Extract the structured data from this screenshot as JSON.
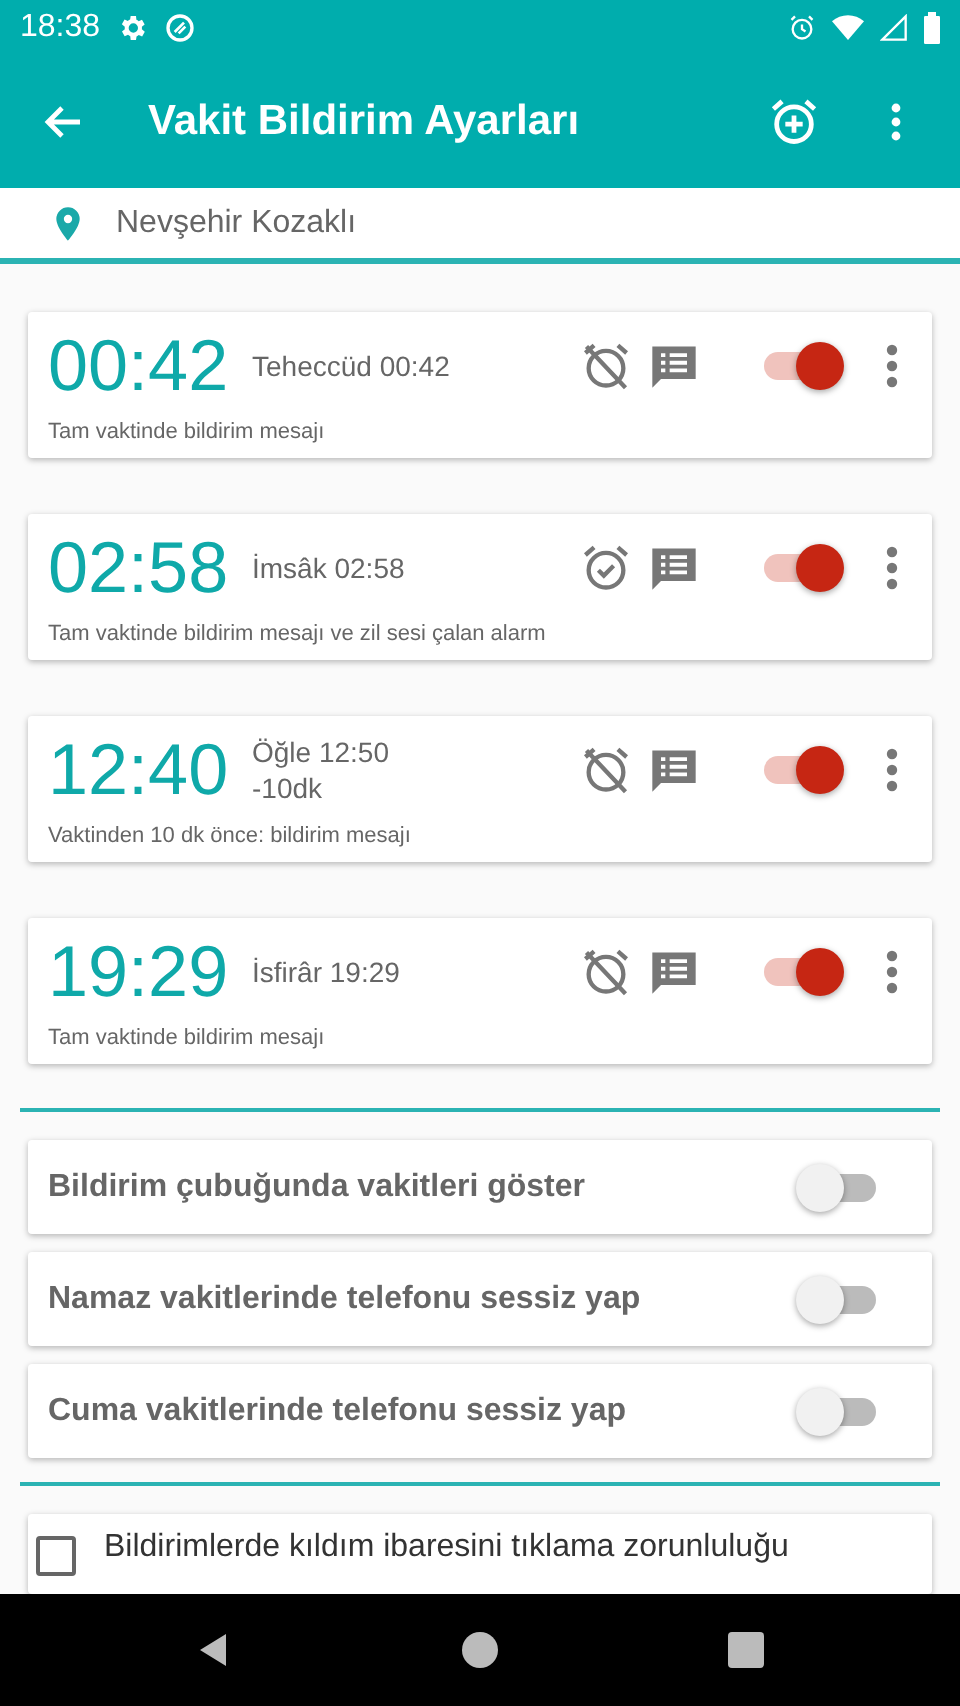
{
  "status_bar": {
    "time": "18:38"
  },
  "app_bar": {
    "title": "Vakit Bildirim Ayarları"
  },
  "location": {
    "text": "Nevşehir Kozaklı"
  },
  "alarms": [
    {
      "time": "00:42",
      "label": [
        "Teheccüd 00:42"
      ],
      "description": "Tam vaktinde bildirim mesajı",
      "alarm": false,
      "on": true
    },
    {
      "time": "02:58",
      "label": [
        "İmsâk 02:58"
      ],
      "description": "Tam vaktinde bildirim mesajı ve zil sesi çalan alarm",
      "alarm": true,
      "on": true
    },
    {
      "time": "12:40",
      "label": [
        "Öğle 12:50",
        "-10dk"
      ],
      "description": "Vaktinden 10 dk önce: bildirim mesajı",
      "alarm": false,
      "on": true
    },
    {
      "time": "19:29",
      "label": [
        "İsfirâr 19:29"
      ],
      "description": "Tam vaktinde bildirim mesajı",
      "alarm": false,
      "on": true
    }
  ],
  "settings": [
    {
      "label": "Bildirim çubuğunda vakitleri göster",
      "on": false
    },
    {
      "label": "Namaz vakitlerinde telefonu sessiz yap",
      "on": false
    },
    {
      "label": "Cuma vakitlerinde telefonu sessiz yap",
      "on": false
    }
  ],
  "options": [
    {
      "label": "Bildirimlerde kıldım ibaresini tıklama zorunluluğu",
      "checked": false
    }
  ]
}
